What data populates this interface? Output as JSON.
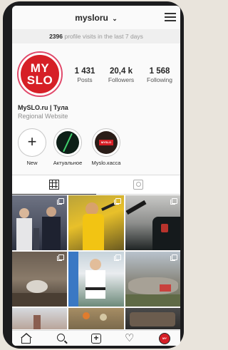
{
  "header": {
    "username": "mysloru",
    "chevron": "⌄"
  },
  "visits": {
    "count": "2396",
    "text": "profile visits in the last 7 days"
  },
  "profile": {
    "avatar_line1": "MY",
    "avatar_line2": "SLO",
    "stats": [
      {
        "value": "1 431",
        "label": "Posts"
      },
      {
        "value": "20,4 k",
        "label": "Followers"
      },
      {
        "value": "1 568",
        "label": "Following"
      }
    ],
    "name": "MySLO.ru | Тула",
    "category": "Regional Website"
  },
  "highlights": [
    {
      "label": "New"
    },
    {
      "label": "Актуальное"
    },
    {
      "label": "Myslo.касса"
    }
  ],
  "highlight_logo": "MYSLO",
  "tabs": [
    {
      "icon": "grid-icon",
      "active": true
    },
    {
      "icon": "tagged-icon",
      "active": false
    }
  ],
  "bottom_nav": [
    {
      "icon": "home-icon"
    },
    {
      "icon": "search-icon"
    },
    {
      "icon": "add-post-icon"
    },
    {
      "icon": "heart-icon"
    },
    {
      "icon": "profile-icon"
    }
  ],
  "nav_avatar": "MY",
  "colors": {
    "brand_red": "#d61f26",
    "story_ring": "#e14a6b",
    "text": "#262626",
    "muted": "#8e8e8e"
  }
}
